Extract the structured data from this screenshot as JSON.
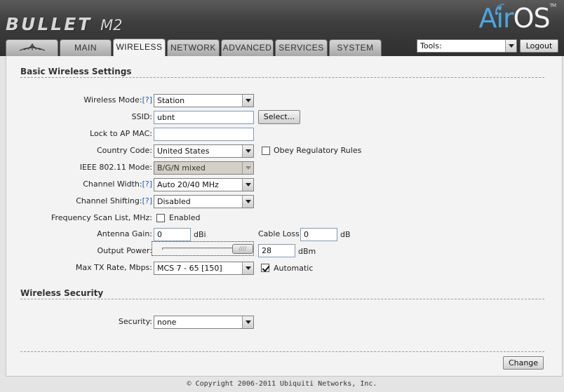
{
  "header": {
    "brand_main": "BULLET",
    "brand_model": "M2",
    "airos_air": "Air",
    "airos_os": "OS",
    "airos_tm": "TM"
  },
  "tabs": [
    {
      "label": "",
      "icon": "ubiquiti-logo-icon"
    },
    {
      "label": "MAIN"
    },
    {
      "label": "WIRELESS",
      "active": true
    },
    {
      "label": "NETWORK"
    },
    {
      "label": "ADVANCED"
    },
    {
      "label": "SERVICES"
    },
    {
      "label": "SYSTEM"
    }
  ],
  "tools": {
    "value": "Tools:"
  },
  "logout_label": "Logout",
  "basic": {
    "title": "Basic Wireless Settings",
    "wireless_mode": {
      "label": "Wireless Mode:",
      "help": "[?]",
      "value": "Station"
    },
    "ssid": {
      "label": "SSID:",
      "value": "ubnt",
      "button": "Select..."
    },
    "lock_ap_mac": {
      "label": "Lock to AP MAC:",
      "value": ""
    },
    "country_code": {
      "label": "Country Code:",
      "value": "United States",
      "checkbox_label": "Obey Regulatory Rules",
      "checked": false
    },
    "ieee_mode": {
      "label": "IEEE 802.11 Mode:",
      "value": "B/G/N mixed"
    },
    "channel_width": {
      "label": "Channel Width:",
      "help": "[?]",
      "value": "Auto 20/40 MHz"
    },
    "channel_shifting": {
      "label": "Channel Shifting:",
      "help": "[?]",
      "value": "Disabled"
    },
    "freq_scan": {
      "label": "Frequency Scan List, MHz:",
      "checkbox_label": "Enabled",
      "checked": false
    },
    "antenna_gain": {
      "label": "Antenna Gain:",
      "value": "0",
      "unit": "dBi"
    },
    "cable_loss": {
      "label": "Cable Loss:",
      "value": "0",
      "unit": "dB"
    },
    "output_power": {
      "label": "Output Power:",
      "value": "28",
      "unit": "dBm",
      "slider_fraction": 1.0
    },
    "max_tx_rate": {
      "label": "Max TX Rate, Mbps:",
      "value": "MCS 7 - 65 [150]",
      "checkbox_label": "Automatic",
      "checked": true
    }
  },
  "security": {
    "title": "Wireless Security",
    "label": "Security:",
    "value": "none"
  },
  "change_label": "Change",
  "copyright": "© Copyright 2006-2011 Ubiquiti Networks, Inc."
}
